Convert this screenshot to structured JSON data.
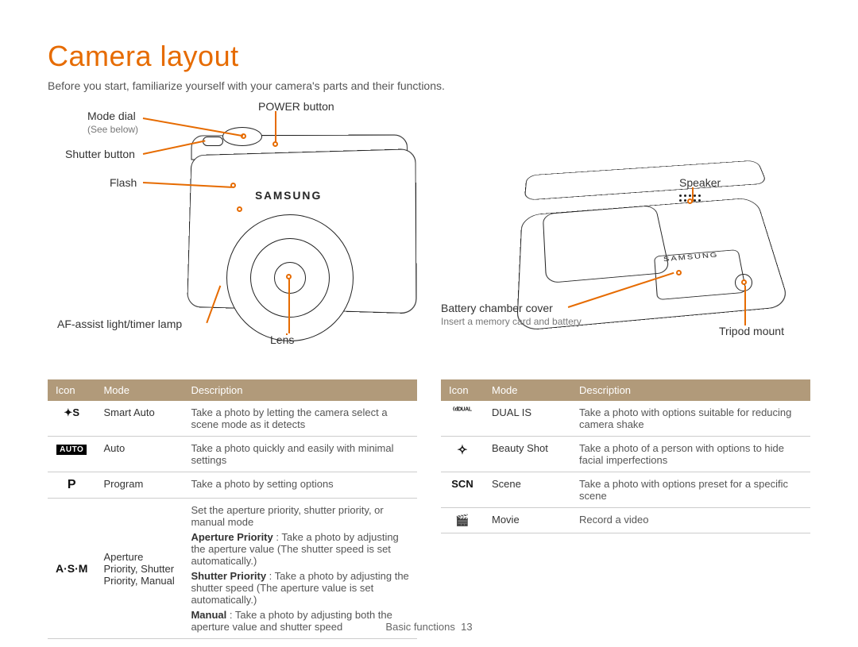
{
  "title": "Camera layout",
  "subtitle": "Before you start, familiarize yourself with your camera's parts and their functions.",
  "labels_front": {
    "mode_dial": "Mode dial",
    "mode_dial_note": "(See below)",
    "power": "POWER button",
    "shutter": "Shutter button",
    "flash": "Flash",
    "af_lamp": "AF-assist light/timer lamp",
    "lens": "Lens",
    "brand": "SAMSUNG"
  },
  "labels_bottom": {
    "speaker": "Speaker",
    "battery": "Battery chamber cover",
    "battery_note": "Insert a memory card and battery",
    "tripod": "Tripod mount",
    "brand": "SAMSUNG"
  },
  "table_headers": {
    "icon": "Icon",
    "mode": "Mode",
    "desc": "Description"
  },
  "table_left": [
    {
      "icon": "✦S",
      "mode": "Smart Auto",
      "desc": "Take a photo by letting the camera select a scene mode as it detects"
    },
    {
      "icon": "AUTO",
      "mode": "Auto",
      "desc": "Take a photo quickly and easily with minimal settings"
    },
    {
      "icon": "P",
      "mode": "Program",
      "desc": "Take a photo by setting options"
    },
    {
      "icon": "A·S·M",
      "mode": "Aperture Priority, Shutter Priority, Manual",
      "desc_intro": "Set the aperture priority, shutter priority, or manual mode",
      "desc_ap_l": "Aperture Priority",
      "desc_ap": " : Take a photo by adjusting the aperture value (The shutter speed is set automatically.)",
      "desc_sp_l": "Shutter Priority",
      "desc_sp": " : Take a photo by adjusting the shutter speed (The aperture value is set automatically.)",
      "desc_m_l": "Manual",
      "desc_m": " : Take a photo by adjusting both the aperture value and shutter speed"
    }
  ],
  "table_right": [
    {
      "icon": "⁽ᵈᴰᵁᴬᴸ",
      "mode": "DUAL IS",
      "desc": "Take a photo with options suitable for reducing camera shake"
    },
    {
      "icon": "✧",
      "mode": "Beauty Shot",
      "desc": "Take a photo of a person with options to hide facial imperfections"
    },
    {
      "icon": "SCN",
      "mode": "Scene",
      "desc": "Take a photo with options preset for a specific scene"
    },
    {
      "icon": "🎬",
      "mode": "Movie",
      "desc": "Record a video"
    }
  ],
  "footer": {
    "section": "Basic functions",
    "page": "13"
  }
}
